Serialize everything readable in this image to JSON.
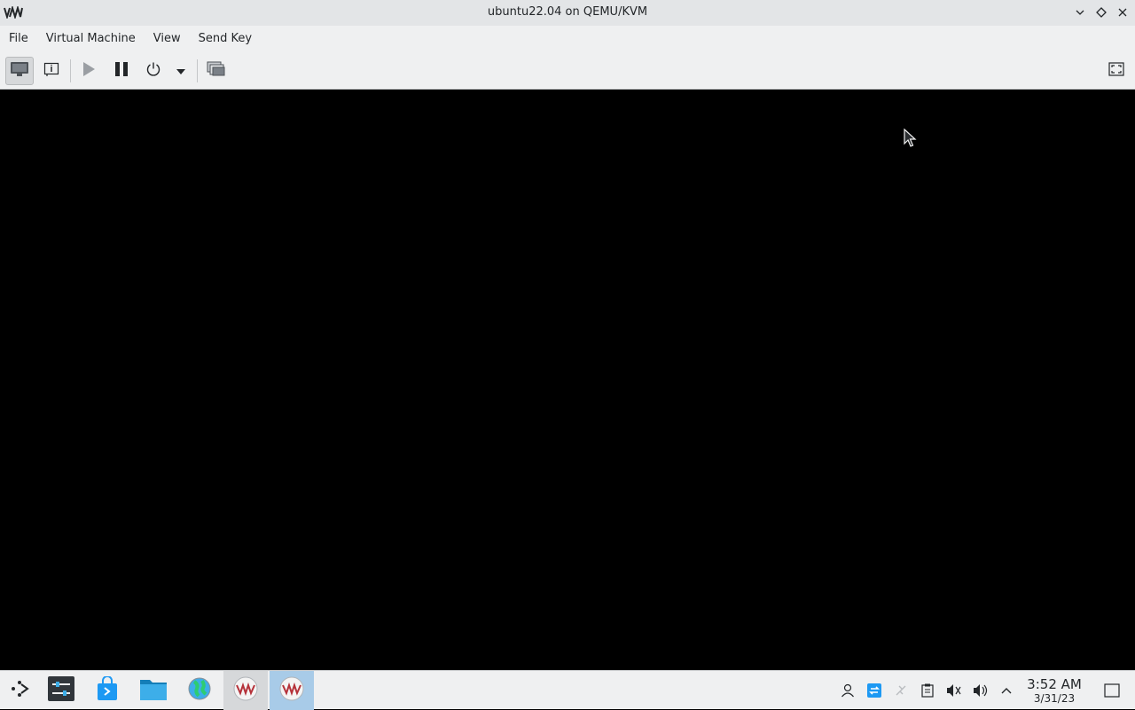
{
  "window": {
    "title": "ubuntu22.04 on QEMU/KVM",
    "app_icon": "virt-manager-logo-icon",
    "controls": [
      "minimize-icon",
      "maximize-icon",
      "close-icon"
    ]
  },
  "menubar": {
    "items": [
      {
        "label": "File"
      },
      {
        "label": "Virtual Machine"
      },
      {
        "label": "View"
      },
      {
        "label": "Send Key"
      }
    ]
  },
  "toolbar": {
    "buttons": [
      {
        "name": "console-view-button",
        "icon": "monitor-icon",
        "active": true
      },
      {
        "name": "details-view-button",
        "icon": "info-icon"
      },
      {
        "name": "run-button",
        "icon": "play-icon",
        "disabled": true
      },
      {
        "name": "pause-button",
        "icon": "pause-icon"
      },
      {
        "name": "shutdown-button",
        "icon": "power-icon"
      },
      {
        "name": "shutdown-menu-button",
        "icon": "chevron-down-icon"
      },
      {
        "name": "snapshots-button",
        "icon": "snapshots-icon"
      },
      {
        "name": "fullscreen-button",
        "icon": "fullscreen-icon"
      }
    ]
  },
  "taskbar": {
    "launcher_icon": "app-launcher-icon",
    "tasks": [
      {
        "name": "system-settings-task",
        "icon": "settings-icon"
      },
      {
        "name": "discover-task",
        "icon": "store-icon"
      },
      {
        "name": "file-manager-task",
        "icon": "folder-icon"
      },
      {
        "name": "browser-task",
        "icon": "globe-icon"
      },
      {
        "name": "virt-manager-task",
        "icon": "virt-manager-icon",
        "state": "open"
      },
      {
        "name": "vm-viewer-task",
        "icon": "virt-manager-icon",
        "state": "active"
      }
    ],
    "tray": [
      "user-icon",
      "update-icon",
      "network-icon",
      "clipboard-icon",
      "audio-muted-icon",
      "volume-icon",
      "chevron-up-icon"
    ],
    "clock": {
      "time": "3:52 AM",
      "date": "3/31/23"
    },
    "show_desktop_icon": "show-desktop-icon"
  },
  "colors": {
    "titlebar_bg": "#e3e5e7",
    "menubar_bg": "#eff0f1",
    "vm_screen_bg": "#000000",
    "active_task_bg": "#a8cbe8"
  }
}
